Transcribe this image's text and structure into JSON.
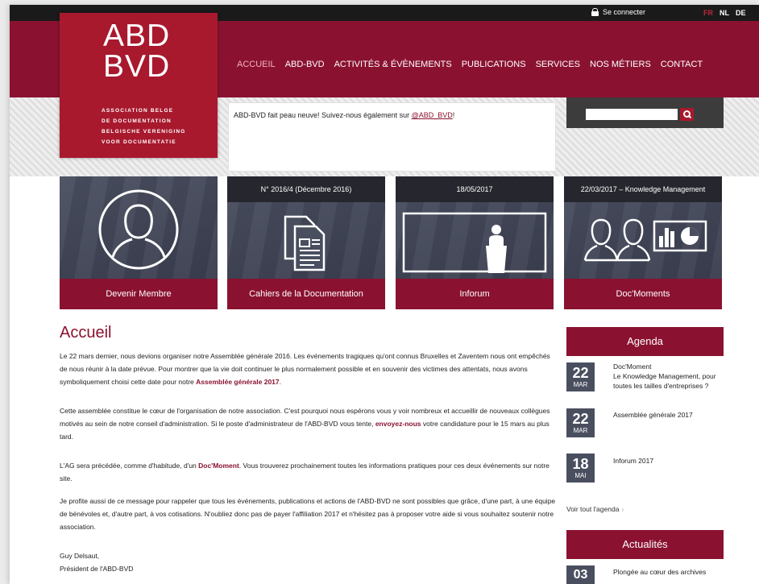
{
  "topbar": {
    "login_label": "Se connecter",
    "languages": [
      {
        "code": "FR",
        "active": true
      },
      {
        "code": "NL",
        "active": false
      },
      {
        "code": "DE",
        "active": false
      }
    ]
  },
  "logo": {
    "line1": "ABD",
    "line2": "BVD",
    "subtitle_lines": [
      "ASSOCIATION BELGE",
      "DE DOCUMENTATION",
      "BELGISCHE VERENIGING",
      "VOOR DOCUMENTATIE"
    ]
  },
  "nav": {
    "items": [
      {
        "label": "ACCUEIL",
        "active": true
      },
      {
        "label": "ABD-BVD",
        "active": false
      },
      {
        "label": "ACTIVITÉS & ÉVÈNEMENTS",
        "active": false
      },
      {
        "label": "PUBLICATIONS",
        "active": false
      },
      {
        "label": "SERVICES",
        "active": false
      },
      {
        "label": "NOS MÉTIERS",
        "active": false
      },
      {
        "label": "CONTACT",
        "active": false
      }
    ]
  },
  "tweet": {
    "text_before": "ABD-BVD fait peau neuve! Suivez-nous également sur ",
    "link": "@ABD_BVD",
    "text_after": "!"
  },
  "search": {
    "placeholder": ""
  },
  "tiles": [
    {
      "header": "",
      "footer": "Devenir Membre",
      "icon": "member-icon"
    },
    {
      "header": "N° 2016/4 (Décembre 2016)",
      "footer": "Cahiers de la Documentation",
      "icon": "documents-icon"
    },
    {
      "header": "18/05/2017",
      "footer": "Inforum",
      "icon": "speaker-icon"
    },
    {
      "header": "22/03/2017 – Knowledge Management",
      "footer": "Doc'Moments",
      "icon": "people-chart-icon"
    }
  ],
  "main": {
    "title": "Accueil",
    "p1": {
      "text": "Le 22 mars dernier, nous devions organiser notre Assemblée générale 2016. Les événements tragiques qu'ont connus Bruxelles et Zaventem nous ont empêchés de nous réunir à la date prévue. Pour montrer que la vie doit continuer le plus normalement possible et en souvenir des victimes des attentats, nous avons symboliquement choisi cette date pour notre ",
      "link": "Assemblée générale 2017",
      "after": "."
    },
    "p2": {
      "text": "Cette assemblée constitue le cœur de l'organisation de notre association. C'est pourquoi nous espérons vous y voir nombreux et accueillir de nouveaux collègues motivés au sein de notre conseil d'administration. Si le poste d'administrateur de l'ABD-BVD vous tente, ",
      "link": "envoyez-nous",
      "after": " votre candidature pour le 15 mars au plus tard."
    },
    "p3": {
      "text": "L'AG sera précédée, comme d'habitude, d'un ",
      "link": "Doc'Moment",
      "after": ". Vous trouverez prochainement toutes les informations pratiques pour ces deux événements sur notre site."
    },
    "p4": "Je profite aussi de ce message pour rappeler que tous les événements, publications et actions de l'ABD-BVD ne sont possibles que grâce, d'une part, à une équipe de bénévoles et, d'autre part, à vos cotisations. N'oubliez donc pas de payer l'affiliation 2017 et n'hésitez pas à proposer votre aide si vous souhaitez soutenir notre association.",
    "signature_name": "Guy Delsaut,",
    "signature_role": "Président de l'ABD-BVD"
  },
  "agenda": {
    "title": "Agenda",
    "events": [
      {
        "day": "22",
        "month": "MAR",
        "text": "Doc'Moment\nLe Knowledge Management, pour toutes les tailles d'entreprises ?"
      },
      {
        "day": "22",
        "month": "MAR",
        "text": "Assemblée générale 2017"
      },
      {
        "day": "18",
        "month": "MAI",
        "text": "Inforum 2017"
      }
    ],
    "see_all": "Voir tout l'agenda"
  },
  "news": {
    "title": "Actualités",
    "items": [
      {
        "day": "03",
        "text": "Plongée au cœur des archives"
      }
    ]
  },
  "colors": {
    "brand": "#8a1230",
    "logo": "#a8192e",
    "tile": "#4a4f60"
  }
}
